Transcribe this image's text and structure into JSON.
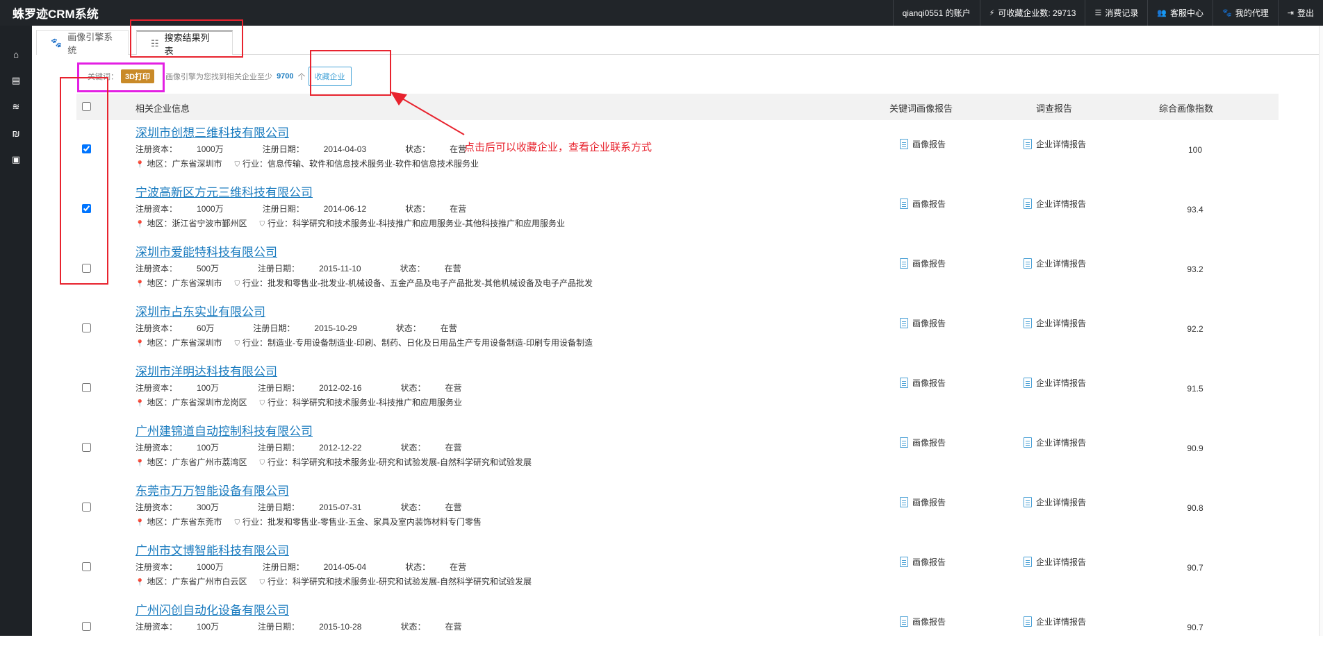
{
  "app": {
    "title": "蛛罗迹CRM系统"
  },
  "topbar": {
    "account": "qianqi0551 的账户",
    "quota_label": "可收藏企业数: 29713",
    "consume": "消费记录",
    "service": "客服中心",
    "agent": "我的代理",
    "logout": "登出"
  },
  "nav_icons": [
    "home-icon",
    "cart-icon",
    "database-icon",
    "yen-icon",
    "archive-icon"
  ],
  "tabs": [
    {
      "label": "画像引擎系统",
      "icon": "paw-icon"
    },
    {
      "label": "搜索结果列表",
      "icon": "list-icon"
    }
  ],
  "search": {
    "keyword_label": "关键词：",
    "keyword": "3D打印",
    "found_prefix": "画像引擎为您找到相关企业至少",
    "found_count": "9700",
    "found_suffix": "个",
    "favorite_button": "收藏企业"
  },
  "table": {
    "headers": {
      "company": "相关企业信息",
      "keyword_report": "关键词画像报告",
      "survey_report": "调查报告",
      "score": "综合画像指数"
    },
    "labels": {
      "capital": "注册资本：",
      "date": "注册日期：",
      "status": "状态：",
      "region": "地区：",
      "industry": "行业：",
      "portrait_report": "画像报告",
      "detail_report": "企业详情报告"
    },
    "rows": [
      {
        "name": "深圳市创想三维科技有限公司",
        "capital": "1000万",
        "date": "2014-04-03",
        "status": "在营",
        "region": "广东省深圳市",
        "industry": "信息传输、软件和信息技术服务业-软件和信息技术服务业",
        "score": "100",
        "checked": true
      },
      {
        "name": "宁波高新区方元三维科技有限公司",
        "capital": "1000万",
        "date": "2014-06-12",
        "status": "在营",
        "region": "浙江省宁波市鄞州区",
        "industry": "科学研究和技术服务业-科技推广和应用服务业-其他科技推广和应用服务业",
        "score": "93.4",
        "checked": true
      },
      {
        "name": "深圳市爱能特科技有限公司",
        "capital": "500万",
        "date": "2015-11-10",
        "status": "在营",
        "region": "广东省深圳市",
        "industry": "批发和零售业-批发业-机械设备、五金产品及电子产品批发-其他机械设备及电子产品批发",
        "score": "93.2",
        "checked": false
      },
      {
        "name": "深圳市占东实业有限公司",
        "capital": "60万",
        "date": "2015-10-29",
        "status": "在营",
        "region": "广东省深圳市",
        "industry": "制造业-专用设备制造业-印刷、制药、日化及日用品生产专用设备制造-印刷专用设备制造",
        "score": "92.2",
        "checked": false
      },
      {
        "name": "深圳市洋明达科技有限公司",
        "capital": "100万",
        "date": "2012-02-16",
        "status": "在营",
        "region": "广东省深圳市龙岗区",
        "industry": "科学研究和技术服务业-科技推广和应用服务业",
        "score": "91.5",
        "checked": false
      },
      {
        "name": "广州建锦道自动控制科技有限公司",
        "capital": "100万",
        "date": "2012-12-22",
        "status": "在营",
        "region": "广东省广州市荔湾区",
        "industry": "科学研究和技术服务业-研究和试验发展-自然科学研究和试验发展",
        "score": "90.9",
        "checked": false
      },
      {
        "name": "东莞市万万智能设备有限公司",
        "capital": "300万",
        "date": "2015-07-31",
        "status": "在营",
        "region": "广东省东莞市",
        "industry": "批发和零售业-零售业-五金、家具及室内装饰材料专门零售",
        "score": "90.8",
        "checked": false
      },
      {
        "name": "广州市文博智能科技有限公司",
        "capital": "1000万",
        "date": "2014-05-04",
        "status": "在营",
        "region": "广东省广州市白云区",
        "industry": "科学研究和技术服务业-研究和试验发展-自然科学研究和试验发展",
        "score": "90.7",
        "checked": false
      },
      {
        "name": "广州闪创自动化设备有限公司",
        "capital": "100万",
        "date": "2015-10-28",
        "status": "在营",
        "region": "",
        "industry": "",
        "score": "90.7",
        "checked": false
      }
    ]
  },
  "annotation": {
    "text": "点击后可以收藏企业，查看企业联系方式"
  },
  "colors": {
    "topbar": "#212529",
    "link": "#1a7bbf",
    "badge": "#c98a28",
    "annotation_red": "#e8232e",
    "annotation_magenta": "#e320e3"
  }
}
